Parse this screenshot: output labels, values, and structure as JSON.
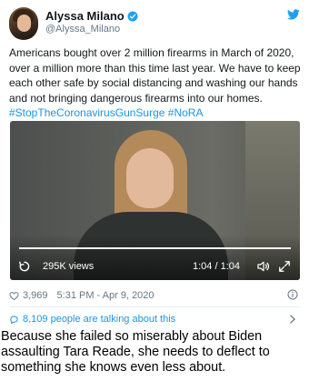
{
  "tweet": {
    "author_name": "Alyssa Milano",
    "handle": "@Alyssa_Milano",
    "text_before": "Americans bought over 2 million firearms in March of 2020, over a million more than this time last year. We have to keep each other safe by social distancing and washing our hands and not bringing dangerous firearms into our homes.",
    "hashtag_1": "#StopTheCoronavirusGunSurge",
    "hashtag_2": "#NoRA",
    "video": {
      "views": "295K views",
      "timecode": "1:04 / 1:04",
      "progress_fraction": 1.0
    },
    "likes": "3,969",
    "timestamp": "5:31 PM - Apr 9, 2020",
    "talking": "8,109 people are talking about this"
  },
  "caption": "Because she failed so miserably about Biden assaulting Tara Reade, she needs to deflect to something she knows even less about.",
  "colors": {
    "link": "#1b95e0",
    "verified": "#1da1f2",
    "secondary_text": "#657786",
    "heart": "#657786"
  },
  "icons": [
    "verified-badge-icon",
    "twitter-bird-icon",
    "replay-icon",
    "volume-icon",
    "fullscreen-icon",
    "heart-icon",
    "info-icon",
    "speech-bubble-icon",
    "chevron-right-icon"
  ]
}
